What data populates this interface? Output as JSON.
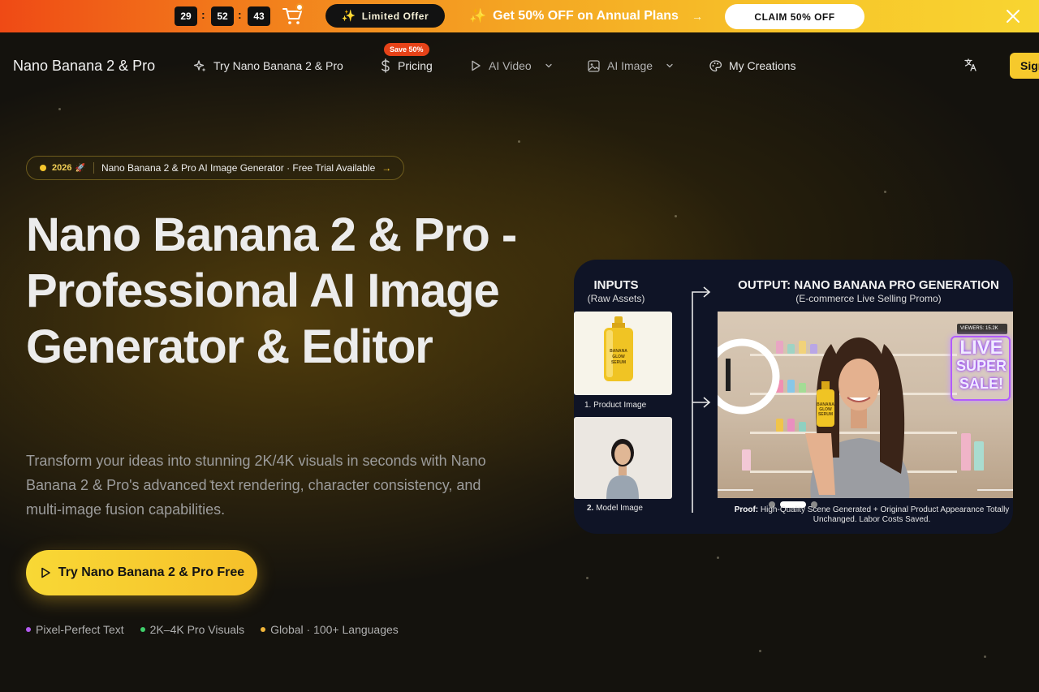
{
  "promo": {
    "countdown": [
      "29",
      "52",
      "43"
    ],
    "separator": ":",
    "limited_offer": "Limited Offer",
    "headline": "Get 50% OFF on Annual Plans",
    "headline_arrow": "→",
    "claim_label": "CLAIM 50% OFF",
    "gradient_start": "#ef4a15",
    "gradient_end": "#f8d531"
  },
  "nav": {
    "brand": "Nano Banana 2 & Pro",
    "items": [
      {
        "label": "Try Nano Banana 2 & Pro",
        "icon": "sparkles-icon"
      },
      {
        "label": "Pricing",
        "icon": "dollar-icon",
        "badge": "Save 50%"
      },
      {
        "label": "AI Video",
        "icon": "play-icon",
        "dropdown": true
      },
      {
        "label": "AI Image",
        "icon": "image-icon",
        "dropdown": true
      },
      {
        "label": "My Creations",
        "icon": "palette-icon"
      }
    ],
    "sign_in": "Sign in",
    "accent": "#f6c92c"
  },
  "hero": {
    "badge_year": "2026",
    "badge_rocket": "🚀",
    "badge_text": "Nano Banana 2 & Pro AI Image Generator · Free Trial Available",
    "badge_arrow": "→",
    "title": "Nano Banana 2 & Pro - Professional AI Image Generator & Editor",
    "subtitle": "Transform your ideas into stunning 2K/4K visuals in seconds with Nano Banana 2 & Pro's advanced text rendering, character consistency, and multi-image fusion capabilities.",
    "cta": "Try Nano Banana 2 & Pro Free",
    "features": [
      {
        "label": "Pixel-Perfect Text",
        "color": "#b35bf0"
      },
      {
        "label": "2K–4K Pro Visuals",
        "color": "#3fcf6a"
      },
      {
        "label": "Global · 100+ Languages",
        "color": "#f0b53a"
      }
    ]
  },
  "showcase": {
    "inputs_title": "INPUTS",
    "inputs_sub": "(Raw Assets)",
    "output_title": "OUTPUT: NANO BANANA PRO GENERATION",
    "output_sub": "(E-commerce Live Selling Promo)",
    "product_caption": "1. Product Image",
    "model_caption_num": "2.",
    "model_caption": "Model Image",
    "bottle_text": "BANANA GLOW SERUM",
    "viewers": "VIEWERS: 15.2K",
    "live_sign": [
      "LIVE",
      "SUPER",
      "SALE!"
    ],
    "proof_label": "Proof:",
    "proof_text": "High-Quality Scene Generated + Original Product Appearance Totally Unchanged. Labor Costs Saved.",
    "carousel_count": 3,
    "carousel_active": 2
  }
}
